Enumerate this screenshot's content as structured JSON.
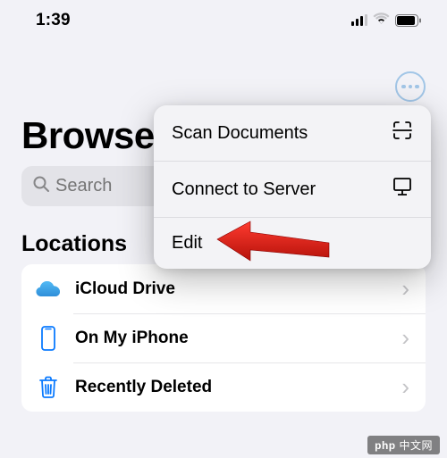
{
  "status": {
    "time": "1:39"
  },
  "page": {
    "title": "Browse"
  },
  "search": {
    "placeholder": "Search"
  },
  "section": {
    "header": "Locations"
  },
  "locations": [
    {
      "label": "iCloud Drive"
    },
    {
      "label": "On My iPhone"
    },
    {
      "label": "Recently Deleted"
    }
  ],
  "menu": {
    "items": [
      {
        "label": "Scan Documents"
      },
      {
        "label": "Connect to Server"
      },
      {
        "label": "Edit"
      }
    ]
  },
  "watermark": {
    "prefix": "php",
    "text": "中文网"
  }
}
